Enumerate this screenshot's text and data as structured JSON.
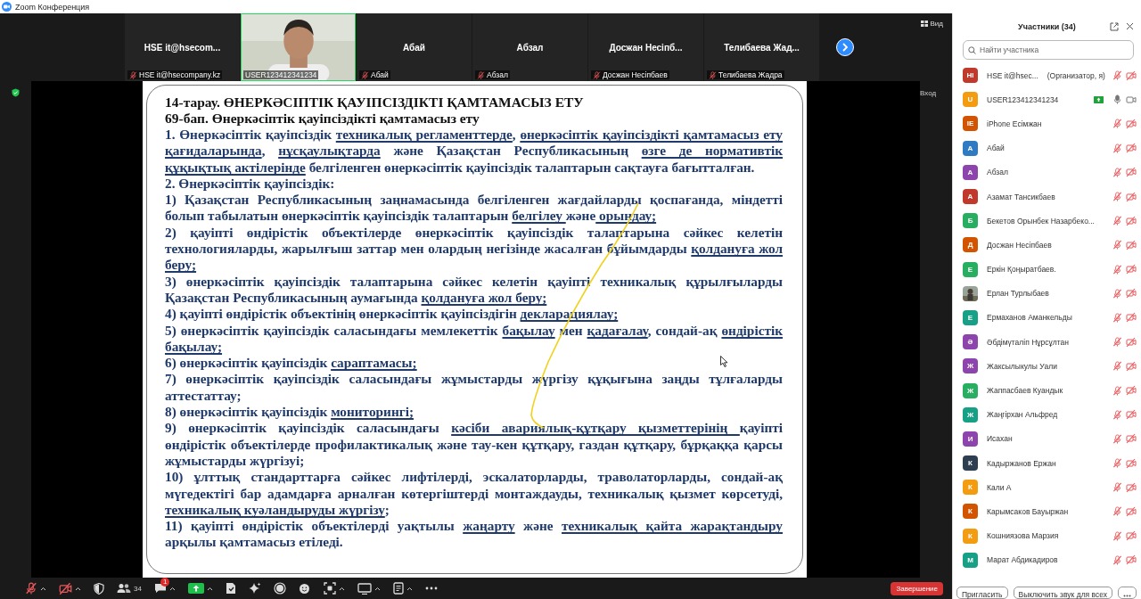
{
  "window": {
    "title": "Zoom Конференция"
  },
  "tiles": [
    {
      "kind": "name",
      "title": "HSE it@hsecom...",
      "label": "HSE it@hsecompany.kz",
      "muted": true,
      "speaking": false
    },
    {
      "kind": "video",
      "label": "USER123412341234",
      "muted": false,
      "speaking": true
    },
    {
      "kind": "name",
      "title": "Абай",
      "label": "Абай",
      "muted": true,
      "speaking": false
    },
    {
      "kind": "name",
      "title": "Абзал",
      "label": "Абзал",
      "muted": true,
      "speaking": false
    },
    {
      "kind": "name",
      "title": "Досжан  Несіпб...",
      "label": "Досжан Несіпбаев",
      "muted": true,
      "speaking": false
    },
    {
      "kind": "name",
      "title": "Телибаева  Жад...",
      "label": "Телибаева Жадра",
      "muted": true,
      "speaking": false
    }
  ],
  "view_button": "Вид",
  "exit_label": "Вход",
  "slide": {
    "headings": [
      "14-тарау. ӨНЕРКӘСІПТІК ҚАУІПСІЗДІКТІ  ҚАМТАМАСЫЗ ЕТУ",
      "69-бап. Өнеркәсіптік қауіпсіздікті қамтамасыз ету"
    ],
    "paragraphs": [
      {
        "segments": [
          {
            "text": "1. Өнеркәсіптік қауіпсіздік ",
            "underline": false
          },
          {
            "text": "техникалық регламенттерде",
            "underline": true
          },
          {
            "text": ", ",
            "underline": false
          },
          {
            "text": "өнеркәсіптік қауіпсіздікті қамтамасыз ету қағидаларында",
            "underline": true
          },
          {
            "text": ", ",
            "underline": false
          },
          {
            "text": "нұсқаулықтарда",
            "underline": true
          },
          {
            "text": " және Қазақстан Республикасының ",
            "underline": false
          },
          {
            "text": "өзге де нормативтік құқықтық актілерінде",
            "underline": true
          },
          {
            "text": " белгіленген өнеркәсіптік қауіпсіздік талаптарын сақтауға бағытталған.",
            "underline": false
          }
        ]
      },
      {
        "segments": [
          {
            "text": "2. Өнеркәсіптік қауіпсіздік:",
            "underline": false
          }
        ]
      },
      {
        "segments": [
          {
            "text": "1) Қазақстан Республикасының заңнамасында белгіленген жағдайларды қоспағанда, міндетті болып табылатын өнеркәсіптік қауіпсіздік талаптарын ",
            "underline": false
          },
          {
            "text": "белгілеу ",
            "underline": true
          },
          {
            "text": "және",
            "underline": false
          },
          {
            "text": " орындау;",
            "underline": true
          }
        ]
      },
      {
        "segments": [
          {
            "text": "2) қауіпті өндірістік объектілерде өнеркәсіптік қауіпсіздік талаптарына сәйкес келетін технологияларды, жарылғыш заттар мен олардың негізінде жасалған бұйымдарды ",
            "underline": false
          },
          {
            "text": "қолдануға жол беру;",
            "underline": true
          }
        ]
      },
      {
        "segments": [
          {
            "text": "3) өнеркәсіптік қауіпсіздік талаптарына сәйкес келетін қауіпті техникалық құрылғыларды Қазақстан Республикасының аумағында ",
            "underline": false
          },
          {
            "text": "қолдануға жол беру;",
            "underline": true
          }
        ]
      },
      {
        "segments": [
          {
            "text": "4) қауіпті өндірістік объектінің өнеркәсіптік қауіпсіздігін ",
            "underline": false
          },
          {
            "text": "декларациялау;",
            "underline": true
          }
        ]
      },
      {
        "segments": [
          {
            "text": "5) өнеркәсіптік қауіпсіздік саласындағы мемлекеттік ",
            "underline": false
          },
          {
            "text": "бақылау",
            "underline": true
          },
          {
            "text": " мен ",
            "underline": false
          },
          {
            "text": "қадағалау",
            "underline": true
          },
          {
            "text": ", сондай-ақ ",
            "underline": false
          },
          {
            "text": "өндірістік бақылау;",
            "underline": true
          }
        ]
      },
      {
        "segments": [
          {
            "text": "6) өнеркәсіптік қауіпсіздік ",
            "underline": false
          },
          {
            "text": "сараптамасы;",
            "underline": true
          }
        ]
      },
      {
        "segments": [
          {
            "text": "7) өнеркәсіптік қауіпсіздік саласындағы жұмыстарды жүргізу құқығына заңды тұлғаларды аттестаттау;",
            "underline": false
          }
        ]
      },
      {
        "segments": [
          {
            "text": "8) өнеркәсіптік қауіпсіздік ",
            "underline": false
          },
          {
            "text": "мониторингі;",
            "underline": true
          }
        ]
      },
      {
        "segments": [
          {
            "text": "9) өнеркәсіптік қауіпсіздік саласындағы ",
            "underline": false
          },
          {
            "text": "кәсіби авариялық-құтқару қызметтерінің ",
            "underline": true
          },
          {
            "text": "қауіпті өндірістік объектілерде профилактикалық және тау-кен құтқару, газдан құтқару, бұрқаққа қарсы жұмыстарды жүргізуі;",
            "underline": false
          }
        ]
      },
      {
        "segments": [
          {
            "text": "10) ұлттық стандарттарға сәйкес лифтілерді, эскалаторларды, траволаторларды, сондай-ақ мүгедектігі бар адамдарға арналған көтергіштерді монтаждауды, техникалық қызмет көрсетуді, ",
            "underline": false
          },
          {
            "text": "техникалық куәландыруды жүргізу",
            "underline": true
          },
          {
            "text": ";",
            "underline": false
          }
        ]
      },
      {
        "segments": [
          {
            "text": "11) қауіпті өндірістік объектілерді уақтылы ",
            "underline": false
          },
          {
            "text": "жаңарту",
            "underline": true
          },
          {
            "text": " және ",
            "underline": false
          },
          {
            "text": "техникалық қайта жарақтандыру ",
            "underline": true
          },
          {
            "text": "арқылы қамтамасыз етіледі.",
            "underline": false
          }
        ]
      }
    ]
  },
  "toolbar": {
    "mic_muted": true,
    "video_off": true,
    "participants_count": "34",
    "chat_badge": "1",
    "end_button": "Завершение"
  },
  "panel": {
    "title": "Участники (34)",
    "search": {
      "placeholder": "Найти участника"
    },
    "participants": [
      {
        "kind": "initials",
        "initials": "HI",
        "color": "#c0392b",
        "name": "HSE it@hsec...",
        "role": "(Организатор, я)",
        "sharing": false,
        "muted": true,
        "video_off": true
      },
      {
        "kind": "initials",
        "initials": "U",
        "color": "#f39c12",
        "name": "USER123412341234",
        "sharing": true,
        "muted": false,
        "video_off": false
      },
      {
        "kind": "initials",
        "initials": "IE",
        "color": "#d35400",
        "name": "iPhone Есімжан",
        "sharing": false,
        "muted": true,
        "video_off": true
      },
      {
        "kind": "initials",
        "initials": "А",
        "color": "#2e7bc4",
        "name": "Абай",
        "sharing": false,
        "muted": true,
        "video_off": true
      },
      {
        "kind": "initials",
        "initials": "А",
        "color": "#8e44ad",
        "name": "Абзал",
        "sharing": false,
        "muted": true,
        "video_off": true
      },
      {
        "kind": "initials",
        "initials": "А",
        "color": "#c0392b",
        "name": "Азамат Тансикбаев",
        "sharing": false,
        "muted": true,
        "video_off": true
      },
      {
        "kind": "initials",
        "initials": "Б",
        "color": "#27ae60",
        "name": "Бекетов Орынбек Назарбеко...",
        "sharing": false,
        "muted": true,
        "video_off": true
      },
      {
        "kind": "initials",
        "initials": "Д",
        "color": "#d35400",
        "name": "Досжан Несіпбаев",
        "sharing": false,
        "muted": true,
        "video_off": true
      },
      {
        "kind": "initials",
        "initials": "Е",
        "color": "#27ae60",
        "name": "Еркін  Қоңыратбаев.",
        "sharing": false,
        "muted": true,
        "video_off": true
      },
      {
        "kind": "picture",
        "name": "Ерлан Турлыбаев",
        "sharing": false,
        "muted": true,
        "video_off": true
      },
      {
        "kind": "initials",
        "initials": "Е",
        "color": "#16a085",
        "name": "Ермаханов Аманкельды",
        "sharing": false,
        "muted": true,
        "video_off": true
      },
      {
        "kind": "initials",
        "initials": "Ә",
        "color": "#8e44ad",
        "name": "Әбдімүталіп Нұрсұлтан",
        "sharing": false,
        "muted": true,
        "video_off": true
      },
      {
        "kind": "initials",
        "initials": "Ж",
        "color": "#8e44ad",
        "name": "Жаксылыкулы Уали",
        "sharing": false,
        "muted": true,
        "video_off": true
      },
      {
        "kind": "initials",
        "initials": "Ж",
        "color": "#27ae60",
        "name": "Жаппасбаев Куандык",
        "sharing": false,
        "muted": true,
        "video_off": true
      },
      {
        "kind": "initials",
        "initials": "Ж",
        "color": "#16a085",
        "name": "Жаңгірхан Альфред",
        "sharing": false,
        "muted": true,
        "video_off": true
      },
      {
        "kind": "initials",
        "initials": "И",
        "color": "#8e44ad",
        "name": "Исахан",
        "sharing": false,
        "muted": true,
        "video_off": true
      },
      {
        "kind": "initials",
        "initials": "К",
        "color": "#2c3e50",
        "name": "Кадыржанов Ержан",
        "sharing": false,
        "muted": true,
        "video_off": true
      },
      {
        "kind": "initials",
        "initials": "К",
        "color": "#f39c12",
        "name": "Кали А",
        "sharing": false,
        "muted": true,
        "video_off": true
      },
      {
        "kind": "initials",
        "initials": "К",
        "color": "#d35400",
        "name": "Карымсаков Бауыржан",
        "sharing": false,
        "muted": true,
        "video_off": true
      },
      {
        "kind": "initials",
        "initials": "К",
        "color": "#f39c12",
        "name": "Кошниязова Марзия",
        "sharing": false,
        "muted": true,
        "video_off": true
      },
      {
        "kind": "initials",
        "initials": "М",
        "color": "#16a085",
        "name": "Марат Абдикадиров",
        "sharing": false,
        "muted": true,
        "video_off": true
      }
    ],
    "buttons": [
      "Пригласить",
      "Выключить звук для всех"
    ]
  }
}
